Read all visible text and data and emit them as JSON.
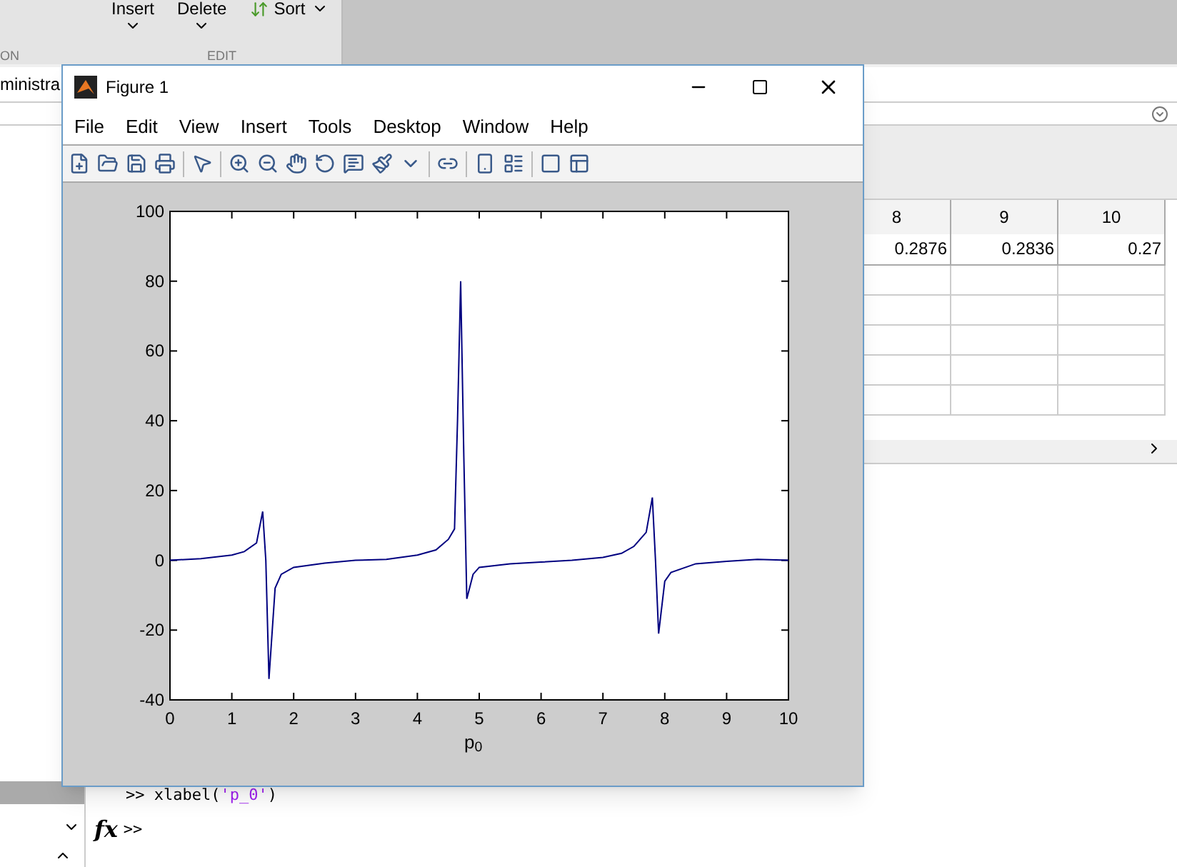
{
  "toolstrip": {
    "buttons": [
      {
        "label": "Insert",
        "kind": "dropdown"
      },
      {
        "label": "Delete",
        "kind": "dropdown"
      },
      {
        "label": "Sort",
        "kind": "sort"
      }
    ],
    "sections": [
      "ON",
      "EDIT"
    ]
  },
  "address": {
    "value": "ministra"
  },
  "variables": {
    "columns": [
      "8",
      "9",
      "10"
    ],
    "rows": [
      [
        "0.2876",
        "0.2836",
        "0.27"
      ]
    ]
  },
  "command_window": {
    "lines": [
      {
        "prompt": ">>",
        "tokens": [
          {
            "kind": "code",
            "text": "xlabel("
          },
          {
            "kind": "string",
            "text": "'p_0'"
          },
          {
            "kind": "code",
            "text": ")"
          }
        ]
      }
    ],
    "fx": "fx",
    "prompt": ">>"
  },
  "figure": {
    "title": "Figure 1",
    "menu": [
      "File",
      "Edit",
      "View",
      "Insert",
      "Tools",
      "Desktop",
      "Window",
      "Help"
    ],
    "chart_data": {
      "type": "line",
      "xlabel": "p$_{0}$",
      "xlim": [
        0,
        10
      ],
      "ylim": [
        -40,
        100
      ],
      "xticks": [
        0,
        1,
        2,
        3,
        4,
        5,
        6,
        7,
        8,
        9,
        10
      ],
      "yticks": [
        -40,
        -20,
        0,
        20,
        40,
        60,
        80,
        100
      ],
      "x": [
        0,
        0.5,
        1,
        1.2,
        1.4,
        1.5,
        1.55,
        1.6,
        1.7,
        1.8,
        2,
        2.5,
        3,
        3.5,
        4,
        4.3,
        4.5,
        4.6,
        4.65,
        4.7,
        4.75,
        4.8,
        4.9,
        5,
        5.5,
        6,
        6.5,
        7,
        7.3,
        7.5,
        7.7,
        7.8,
        7.85,
        7.9,
        8,
        8.1,
        8.5,
        9,
        9.5,
        10
      ],
      "series": [
        {
          "color": "#000080",
          "values": [
            0,
            0.5,
            1.5,
            2.5,
            5,
            14,
            0,
            -34,
            -8,
            -4,
            -2,
            -0.8,
            0,
            0.3,
            1.5,
            3,
            6,
            9,
            40,
            80,
            30,
            -11,
            -4,
            -2,
            -1,
            -0.5,
            0,
            0.8,
            2,
            4,
            8,
            18,
            0,
            -21,
            -6,
            -3.5,
            -1,
            -0.3,
            0.3,
            0
          ]
        }
      ]
    }
  }
}
